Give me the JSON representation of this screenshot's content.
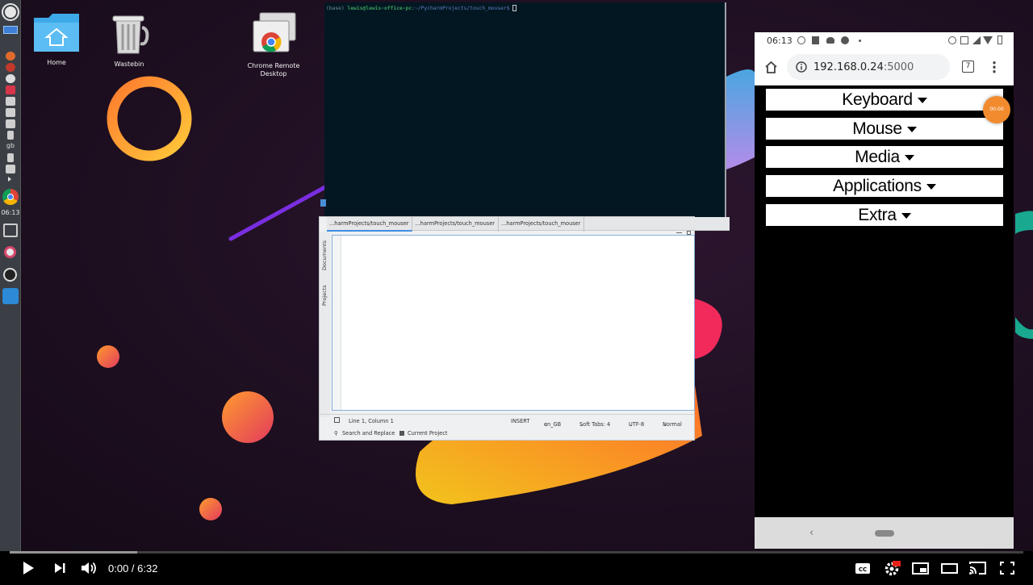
{
  "desktop": {
    "icons": [
      {
        "label": "Home"
      },
      {
        "label": "Wastebin"
      },
      {
        "label": "Chrome Remote Desktop"
      }
    ],
    "dock_clock": "06:13"
  },
  "terminal": {
    "prompt_env": "(base)",
    "prompt_user": "lewis@lewis-office-pc",
    "prompt_path": ":~/PycharmProjects/touch_mouser$"
  },
  "editor": {
    "tabs": [
      "...harmProjects/touch_mouser",
      "...harmProjects/touch_mouser",
      "...harmProjects/touch_mouser"
    ],
    "side_labels": [
      "Documents",
      "Projects"
    ],
    "status": {
      "position": "Line 1, Column 1",
      "mode": "INSERT",
      "language": "en_GB",
      "tabs": "Soft Tabs: 4",
      "encoding": "UTF-8",
      "view": "Normal"
    },
    "bottom": {
      "search": "Search and Replace",
      "project": "Current Project"
    }
  },
  "phone": {
    "time": "06:13",
    "address": "192.168.0.24",
    "port": ":5000",
    "tab_count": "7",
    "menu": [
      "Keyboard",
      "Mouse",
      "Media",
      "Applications",
      "Extra"
    ],
    "badge": "00:00"
  },
  "player": {
    "current_time": "0:00",
    "duration": "6:32",
    "loaded_fraction": 0.126,
    "time_separator": " / "
  },
  "colors": {
    "terminal_bg": "#031722",
    "desktop_bg": "#1e0f21",
    "badge": "#f28b2e",
    "accent_orange": "#ff9a3a"
  }
}
